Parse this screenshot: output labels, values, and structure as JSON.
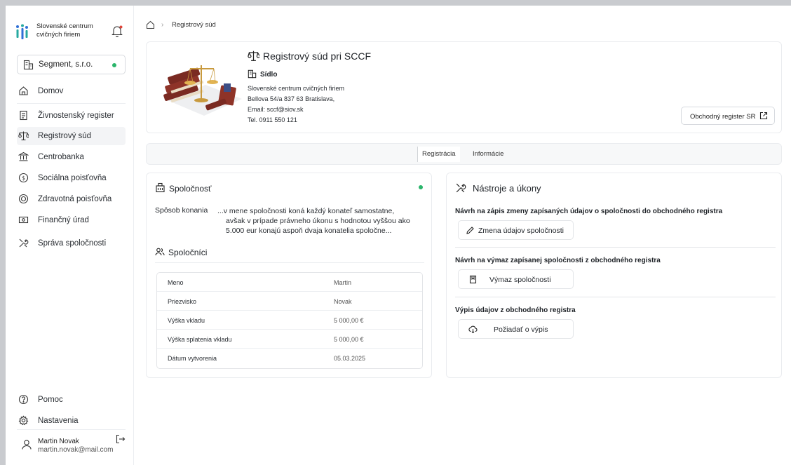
{
  "brand": {
    "name_line1": "Slovenské centrum",
    "name_line2": "cvičných firiem"
  },
  "org_selector": {
    "label": "Segment, s.r.o."
  },
  "nav": {
    "items": [
      {
        "label": "Domov",
        "icon": "home-icon"
      },
      {
        "label": "Živnostenský register",
        "icon": "document-icon"
      },
      {
        "label": "Registrový súd",
        "icon": "scales-icon",
        "active": true
      },
      {
        "label": "Centrobanka",
        "icon": "bank-icon"
      },
      {
        "label": "Sociálna poisťovňa",
        "icon": "shield-icon"
      },
      {
        "label": "Zdravotná poisťovňa",
        "icon": "health-icon"
      },
      {
        "label": "Finančný úrad",
        "icon": "money-icon"
      },
      {
        "label": "Správa spoločnosti",
        "icon": "tools-icon"
      }
    ],
    "bottom": [
      {
        "label": "Pomoc",
        "icon": "help-icon"
      },
      {
        "label": "Nastavenia",
        "icon": "settings-icon"
      }
    ]
  },
  "user": {
    "name": "Martin Novak",
    "email": "martin.novak@mail.com"
  },
  "breadcrumb": {
    "current": "Registrový súd"
  },
  "header": {
    "title": "Registrový súd pri SCCF",
    "sidlo_label": "Sídlo",
    "address": [
      "Slovenské centrum cvičných firiem",
      "Bellova 54/a 837 63 Bratislava,",
      "Email: sccf@siov.sk",
      "Tel. 0911 550 121"
    ],
    "external_button": "Obchodný register SR"
  },
  "tabs": {
    "active": "Registrácia",
    "other": "Informácie"
  },
  "company": {
    "title": "Spoločnosť",
    "sposob_label": "Spôsob konania",
    "sposob_lines": [
      "...v mene spoločnosti koná každý konateľ samostatne,",
      "avšak v prípade právneho úkonu s hodnotou vyššou ako",
      "5.000 eur konajú aspoň dvaja konatelia spoločne..."
    ],
    "partners_title": "Spoločníci",
    "rows": [
      {
        "k": "Meno",
        "v": "Martin"
      },
      {
        "k": "Priezvisko",
        "v": "Novak"
      },
      {
        "k": "Výška vkladu",
        "v": "5 000,00 €"
      },
      {
        "k": "Výška splatenia vkladu",
        "v": "5 000,00 €"
      },
      {
        "k": "Dátum vytvorenia",
        "v": "05.03.2025"
      }
    ]
  },
  "tools": {
    "title": "Nástroje a úkony",
    "sections": [
      {
        "title": "Návrh na zápis zmeny zapísaných údajov o spoločnosti do obchodného registra",
        "button": "Zmena údajov spoločnosti"
      },
      {
        "title": "Návrh na výmaz zapísanej spoločnosti z obchodného registra",
        "button": "Výmaz spoločnosti"
      },
      {
        "title": "Výpis údajov z obchodného registra",
        "button": "Požiadať o výpis"
      }
    ]
  },
  "colors": {
    "status_green": "#2bb56b",
    "brand_blue": "#2f6fd6",
    "brand_teal": "#27a9a1"
  }
}
